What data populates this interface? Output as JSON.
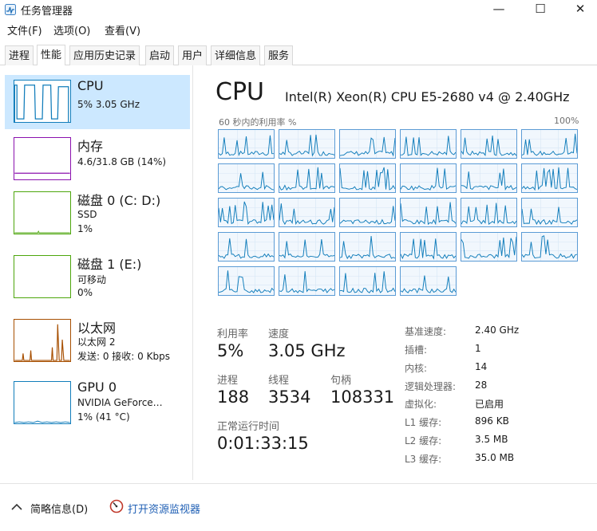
{
  "window": {
    "title": "任务管理器",
    "controls": {
      "minimize": "—",
      "maximize": "☐",
      "close": "✕"
    }
  },
  "menu": [
    "文件(F)",
    "选项(O)",
    "查看(V)"
  ],
  "tabs": [
    {
      "label": "进程",
      "active": false
    },
    {
      "label": "性能",
      "active": true
    },
    {
      "label": "应用历史记录",
      "active": false
    },
    {
      "label": "启动",
      "active": false
    },
    {
      "label": "用户",
      "active": false
    },
    {
      "label": "详细信息",
      "active": false
    },
    {
      "label": "服务",
      "active": false
    }
  ],
  "sidebar": {
    "items": [
      {
        "title": "CPU",
        "lines": [
          "5% 3.05 GHz"
        ],
        "color": "#117dbb",
        "icon": "cpu-graph-icon"
      },
      {
        "title": "内存",
        "lines": [
          "4.6/31.8 GB (14%)"
        ],
        "color": "#8b12ae",
        "icon": "memory-graph-icon"
      },
      {
        "title": "磁盘 0 (C: D:)",
        "lines": [
          "SSD",
          "1%"
        ],
        "color": "#4da60c",
        "icon": "disk-graph-icon"
      },
      {
        "title": "磁盘 1 (E:)",
        "lines": [
          "可移动",
          "0%"
        ],
        "color": "#4da60c",
        "icon": "disk-graph-icon"
      },
      {
        "title": "以太网",
        "lines": [
          "以太网 2",
          "发送: 0 接收: 0 Kbps"
        ],
        "color": "#a74f01",
        "icon": "ethernet-graph-icon"
      },
      {
        "title": "GPU 0",
        "lines": [
          "NVIDIA GeForce…",
          "1% (41 °C)"
        ],
        "color": "#117dbb",
        "icon": "gpu-graph-icon"
      }
    ]
  },
  "main": {
    "title": "CPU",
    "model": "Intel(R) Xeon(R) CPU E5-2680 v4 @ 2.40GHz",
    "graph_left_label": "60 秒内的利用率 %",
    "graph_right_label": "100%",
    "core_graph_count": 28,
    "stats": {
      "utilization_label": "利用率",
      "utilization_value": "5%",
      "speed_label": "速度",
      "speed_value": "3.05 GHz",
      "processes_label": "进程",
      "processes_value": "188",
      "threads_label": "线程",
      "threads_value": "3534",
      "handles_label": "句柄",
      "handles_value": "108331",
      "uptime_label": "正常运行时间",
      "uptime_value": "0:01:33:15"
    },
    "specs": [
      {
        "label": "基准速度:",
        "value": "2.40 GHz"
      },
      {
        "label": "插槽:",
        "value": "1"
      },
      {
        "label": "内核:",
        "value": "14"
      },
      {
        "label": "逻辑处理器:",
        "value": "28"
      },
      {
        "label": "虚拟化:",
        "value": "已启用"
      },
      {
        "label": "L1 缓存:",
        "value": "896 KB"
      },
      {
        "label": "L2 缓存:",
        "value": "3.5 MB"
      },
      {
        "label": "L3 缓存:",
        "value": "35.0 MB"
      }
    ]
  },
  "footer": {
    "summary_label": "简略信息(D)",
    "monitor_label": "打开资源监视器"
  },
  "colors": {
    "selected_bg": "#cce8ff",
    "cpu_line": "#117dbb",
    "cpu_cell_border": "#5b9bd5",
    "link": "#1f5fb4"
  }
}
